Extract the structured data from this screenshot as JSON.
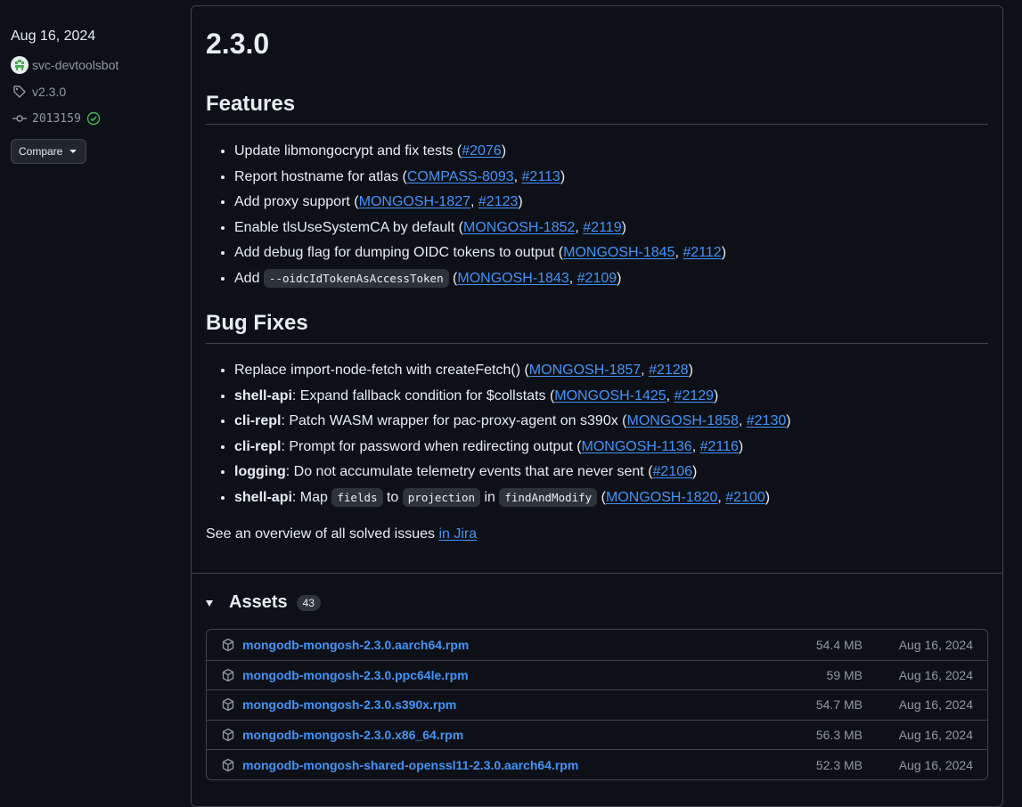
{
  "meta": {
    "date": "Aug 16, 2024",
    "author": "svc-devtoolsbot",
    "tag": "v2.3.0",
    "commit": "2013159",
    "compare_label": "Compare"
  },
  "release": {
    "title": "2.3.0",
    "features_heading": "Features",
    "features": [
      {
        "text": "Update libmongocrypt and fix tests (",
        "links": [
          "#2076"
        ],
        "tail": ")"
      },
      {
        "text": "Report hostname for atlas (",
        "links": [
          "COMPASS-8093",
          "#2113"
        ],
        "tail": ")"
      },
      {
        "text": "Add proxy support (",
        "links": [
          "MONGOSH-1827",
          "#2123"
        ],
        "tail": ")"
      },
      {
        "text": "Enable tlsUseSystemCA by default (",
        "links": [
          "MONGOSH-1852",
          "#2119"
        ],
        "tail": ")"
      },
      {
        "text": "Add debug flag for dumping OIDC tokens to output (",
        "links": [
          "MONGOSH-1845",
          "#2112"
        ],
        "tail": ")"
      },
      {
        "pre": "Add ",
        "code": "--oidcIdTokenAsAccessToken",
        "text": " (",
        "links": [
          "MONGOSH-1843",
          "#2109"
        ],
        "tail": ")"
      }
    ],
    "bugfixes_heading": "Bug Fixes",
    "bugfixes": [
      {
        "text": "Replace import-node-fetch with createFetch() (",
        "links": [
          "MONGOSH-1857",
          "#2128"
        ],
        "tail": ")"
      },
      {
        "scope": "shell-api",
        "text": ": Expand fallback condition for $collstats (",
        "links": [
          "MONGOSH-1425",
          "#2129"
        ],
        "tail": ")"
      },
      {
        "scope": "cli-repl",
        "text": ": Patch WASM wrapper for pac-proxy-agent on s390x (",
        "links": [
          "MONGOSH-1858",
          "#2130"
        ],
        "tail": ")"
      },
      {
        "scope": "cli-repl",
        "text": ": Prompt for password when redirecting output (",
        "links": [
          "MONGOSH-1136",
          "#2116"
        ],
        "tail": ")"
      },
      {
        "scope": "logging",
        "text": ": Do not accumulate telemetry events that are never sent (",
        "links": [
          "#2106"
        ],
        "tail": ")"
      },
      {
        "scope": "shell-api",
        "text": ": Map ",
        "codes": [
          "fields",
          "projection",
          "findAndModify"
        ],
        "joiners": [
          " to ",
          " in ",
          " ("
        ],
        "links": [
          "MONGOSH-1820",
          "#2100"
        ],
        "tail": ")"
      }
    ],
    "overview_text": "See an overview of all solved issues ",
    "overview_link": "in Jira"
  },
  "assets": {
    "label": "Assets",
    "count": "43",
    "files": [
      {
        "name": "mongodb-mongosh-2.3.0.aarch64.rpm",
        "size": "54.4 MB",
        "date": "Aug 16, 2024"
      },
      {
        "name": "mongodb-mongosh-2.3.0.ppc64le.rpm",
        "size": "59 MB",
        "date": "Aug 16, 2024"
      },
      {
        "name": "mongodb-mongosh-2.3.0.s390x.rpm",
        "size": "54.7 MB",
        "date": "Aug 16, 2024"
      },
      {
        "name": "mongodb-mongosh-2.3.0.x86_64.rpm",
        "size": "56.3 MB",
        "date": "Aug 16, 2024"
      },
      {
        "name": "mongodb-mongosh-shared-openssl11-2.3.0.aarch64.rpm",
        "size": "52.3 MB",
        "date": "Aug 16, 2024"
      }
    ]
  }
}
